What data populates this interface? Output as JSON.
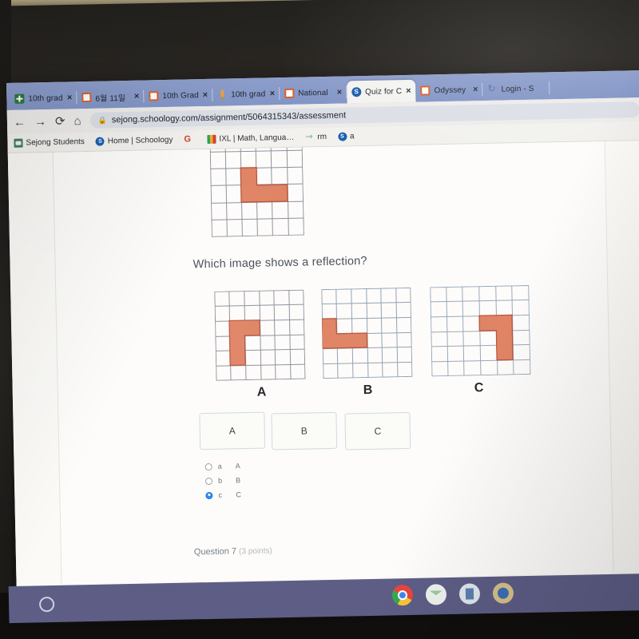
{
  "browser": {
    "tabs": [
      {
        "label": "10th grad",
        "favicon": "sheets-icon",
        "active": false,
        "close": "×"
      },
      {
        "label": "6월 11일",
        "favicon": "slides-icon",
        "active": false,
        "close": "×"
      },
      {
        "label": "10th Grad",
        "favicon": "slides-icon",
        "active": false,
        "close": "×"
      },
      {
        "label": "10th grad",
        "favicon": "pin-icon",
        "active": false,
        "close": "×"
      },
      {
        "label": "National",
        "favicon": "slides-icon",
        "active": false,
        "close": "×"
      },
      {
        "label": "Quiz for C",
        "favicon": "schoology-icon",
        "active": true,
        "close": "×"
      },
      {
        "label": "Odyssey",
        "favicon": "slides-icon",
        "active": false,
        "close": "×"
      },
      {
        "label": "Login - S",
        "favicon": "login-icon",
        "active": false,
        "close": ""
      }
    ],
    "toolbar": {
      "back": "←",
      "forward": "→",
      "reload": "⟳",
      "home": "⌂",
      "lock": "🔒",
      "url": "sejong.schoology.com/assignment/5064315343/assessment"
    },
    "bookmarks": [
      {
        "label": "Sejong Students",
        "icon": "folder-icon"
      },
      {
        "label": "Home | Schoology",
        "icon": "schoology-icon"
      },
      {
        "label": "",
        "icon": "google-icon"
      },
      {
        "label": "IXL | Math, Langua…",
        "icon": "ixl-icon"
      },
      {
        "label": "rm",
        "icon": "link-icon"
      },
      {
        "label": "a",
        "icon": "schoology-icon"
      }
    ]
  },
  "quiz": {
    "question_text": "Which image shows a reflection?",
    "option_labels": [
      "A",
      "B",
      "C"
    ],
    "choice_buttons": [
      "A",
      "B",
      "C"
    ],
    "radio_options": [
      {
        "letter": "a",
        "value": "A",
        "selected": false
      },
      {
        "letter": "b",
        "value": "B",
        "selected": false
      },
      {
        "letter": "c",
        "value": "C",
        "selected": true
      }
    ],
    "footer_question": "Question 7",
    "footer_points": "(3 points)",
    "shape_fill": "#e08465",
    "shape_stroke": "#b4543a",
    "grid_line": "#8d929c"
  },
  "shelf": {
    "launcher": "launcher-circle",
    "apps": [
      "chrome-icon",
      "mail-icon",
      "doc-icon",
      "blue-app-icon"
    ]
  }
}
